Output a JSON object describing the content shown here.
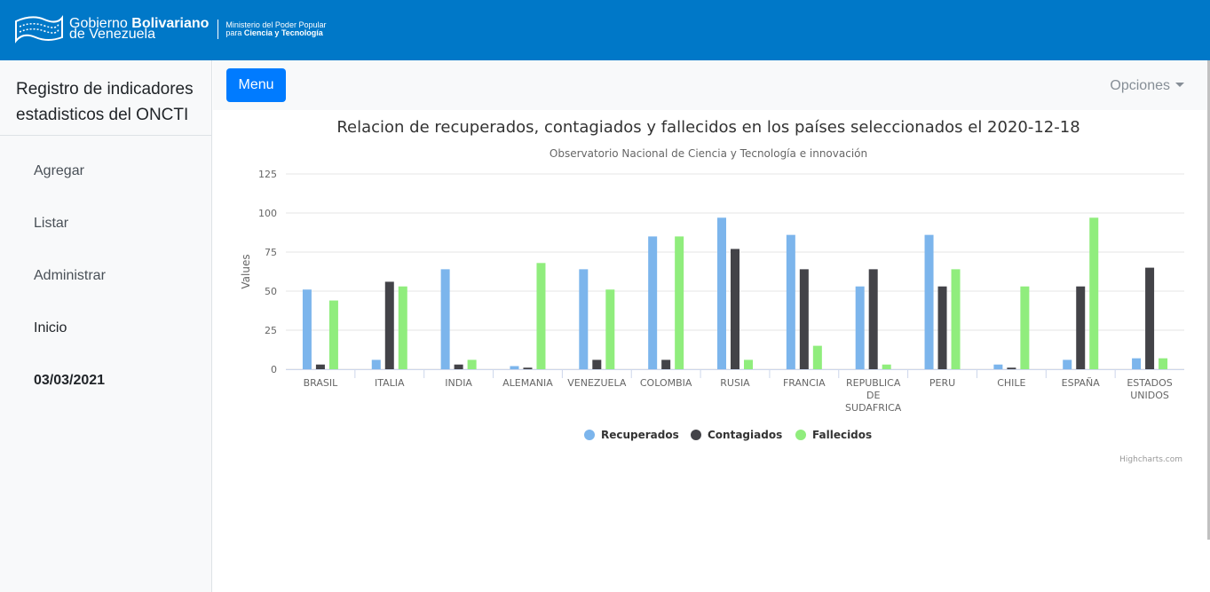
{
  "header": {
    "gob_line1_a": "Gobierno ",
    "gob_line1_b": "Bolivariano",
    "gob_line2": "de Venezuela",
    "min_line1": "Ministerio del Poder Popular",
    "min_line2_a": "para ",
    "min_line2_b": "Ciencia y Tecnología",
    "bg_color": "#0078c8"
  },
  "sidebar": {
    "title": "Registro de indicadores estadisticos del ONCTI",
    "items": [
      {
        "label": "Agregar"
      },
      {
        "label": "Listar"
      },
      {
        "label": "Administrar"
      },
      {
        "label": "Inicio"
      },
      {
        "label": "03/03/2021"
      }
    ]
  },
  "toolbar": {
    "menu_label": "Menu",
    "options_label": "Opciones"
  },
  "chart_data": {
    "type": "bar",
    "title": "Relacion de recuperados, contagiados y fallecidos en los países seleccionados el 2020-12-18",
    "subtitle": "Observatorio Nacional de Ciencia y Tecnología e innovación",
    "ylabel": "Values",
    "xlabel": "",
    "ylim": [
      0,
      125
    ],
    "yticks": [
      0,
      25,
      50,
      75,
      100,
      125
    ],
    "grid": true,
    "legend_placement": "bottom-center",
    "credits": "Highcharts.com",
    "categories": [
      "BRASIL",
      "ITALIA",
      "INDIA",
      "ALEMANIA",
      "VENEZUELA",
      "COLOMBIA",
      "RUSIA",
      "FRANCIA",
      "REPUBLICA DE SUDAFRICA",
      "PERU",
      "CHILE",
      "ESPAÑA",
      "ESTADOS UNIDOS"
    ],
    "series": [
      {
        "name": "Recuperados",
        "color": "#7cb5ec",
        "values": [
          51,
          6,
          64,
          2,
          64,
          85,
          97,
          86,
          53,
          86,
          3,
          6,
          7
        ]
      },
      {
        "name": "Contagiados",
        "color": "#434348",
        "values": [
          3,
          56,
          3,
          1,
          6,
          6,
          77,
          64,
          64,
          53,
          1,
          53,
          65
        ]
      },
      {
        "name": "Fallecidos",
        "color": "#90ed7d",
        "values": [
          44,
          53,
          6,
          68,
          51,
          85,
          6,
          15,
          3,
          64,
          53,
          97,
          7
        ]
      }
    ]
  }
}
